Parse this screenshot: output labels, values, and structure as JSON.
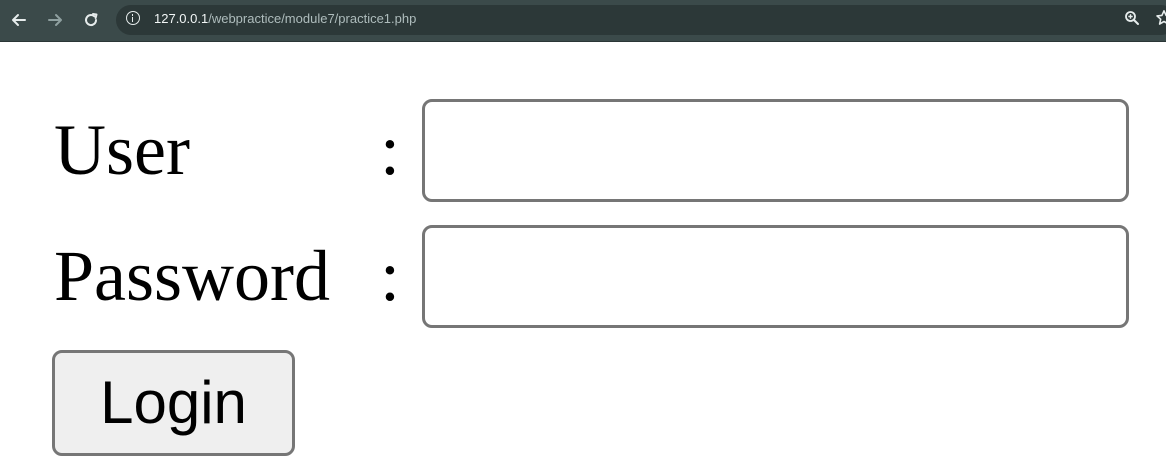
{
  "browser": {
    "back_icon": "arrow-left-icon",
    "forward_icon": "arrow-right-icon",
    "reload_icon": "reload-icon",
    "site_info_icon": "info-icon",
    "url_host": "127.0.0.1",
    "url_path": "/webpractice/module7/practice1.php",
    "zoom_icon": "zoom-icon",
    "bookmark_icon": "star-icon",
    "bar_color": "#3b4a4a"
  },
  "form": {
    "user_label": "User",
    "password_label": "Password",
    "separator": ":",
    "user_value": "",
    "password_value": "",
    "login_label": "Login"
  }
}
